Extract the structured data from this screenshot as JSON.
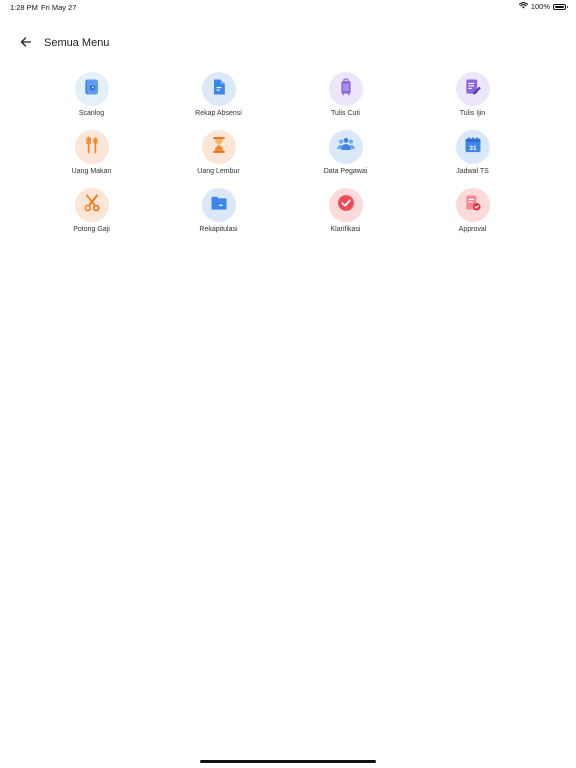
{
  "status_bar": {
    "time": "1:28 PM",
    "date": "Fri May 27",
    "battery": "100%"
  },
  "header": {
    "back_icon": "arrow-left-icon",
    "title": "Semua Menu"
  },
  "menu": [
    {
      "label": "Scanlog",
      "icon": "scan-clock-icon",
      "bg": "#e6f0fb",
      "color": "#3d86e8"
    },
    {
      "label": "Rekap Absensi",
      "icon": "document-icon",
      "bg": "#dbe8f8",
      "color": "#3d86e8"
    },
    {
      "label": "Tulis Cuti",
      "icon": "suitcase-icon",
      "bg": "#ece6f8",
      "color": "#8c67d8"
    },
    {
      "label": "Tulis Ijin",
      "icon": "edit-document-icon",
      "bg": "#ece6f8",
      "color": "#8c67d8"
    },
    {
      "label": "Uang Makan",
      "icon": "fork-spoon-icon",
      "bg": "#fbe5d6",
      "color": "#f08a2c"
    },
    {
      "label": "Uang Lembur",
      "icon": "hourglass-icon",
      "bg": "#fbe5d6",
      "color": "#f08a2c"
    },
    {
      "label": "Data Pegawai",
      "icon": "people-icon",
      "bg": "#dbe8f8",
      "color": "#3d86e8"
    },
    {
      "label": "Jadwal TS",
      "icon": "calendar-icon",
      "bg": "#dbe8f8",
      "color": "#3d86e8"
    },
    {
      "label": "Potong Gaji",
      "icon": "scissors-icon",
      "bg": "#fbe5d6",
      "color": "#f08a2c"
    },
    {
      "label": "Rekapitulasi",
      "icon": "folder-icon",
      "bg": "#dbe8f8",
      "color": "#3d86e8"
    },
    {
      "label": "Klarifikasi",
      "icon": "check-circle-icon",
      "bg": "#fbdada",
      "color": "#ee4a55"
    },
    {
      "label": "Approval",
      "icon": "approval-document-icon",
      "bg": "#fbdada",
      "color": "#ee4a55"
    }
  ],
  "calendar_day": "31"
}
